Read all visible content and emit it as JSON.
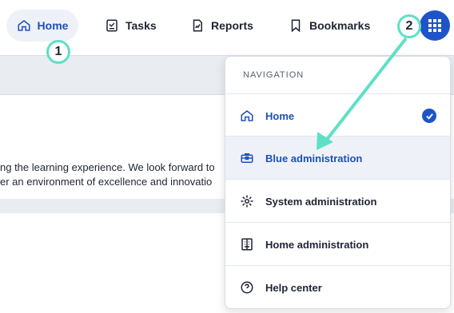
{
  "topnav": {
    "home": "Home",
    "tasks": "Tasks",
    "reports": "Reports",
    "bookmarks": "Bookmarks"
  },
  "card": {
    "line1": "ng the learning experience. We look forward to",
    "line2": "er an environment of excellence and innovatio"
  },
  "dropdown": {
    "header": "NAVIGATION",
    "items": [
      {
        "label": "Home",
        "icon": "home-icon",
        "selected": true
      },
      {
        "label": "Blue administration",
        "icon": "briefcase-icon"
      },
      {
        "label": "System administration",
        "icon": "gear-icon"
      },
      {
        "label": "Home administration",
        "icon": "building-icon"
      },
      {
        "label": "Help center",
        "icon": "help-icon"
      }
    ]
  },
  "annotations": {
    "one": "1",
    "two": "2"
  },
  "colors": {
    "accent": "#1e54c8",
    "callout": "#5ee0c5"
  }
}
